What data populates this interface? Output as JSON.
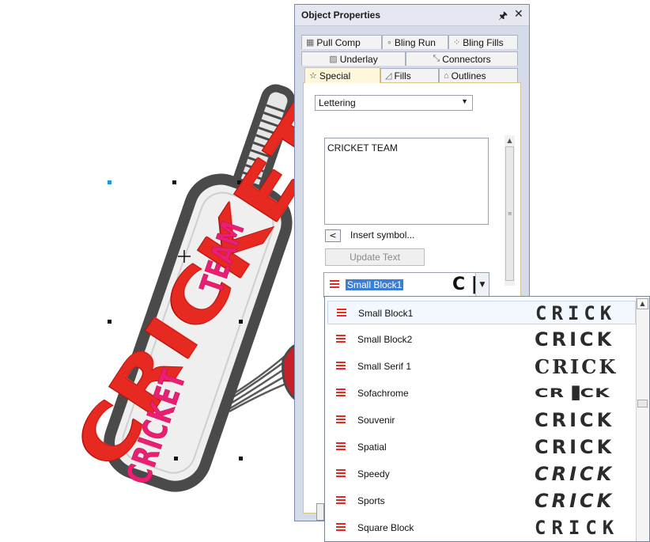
{
  "canvas": {
    "big_text": "CRICKET",
    "bat_text_left": "CRICKET",
    "bat_text_right": "TEAM"
  },
  "panel": {
    "title": "Object Properties",
    "pin_icon": "pin-icon",
    "close_icon": "close-icon",
    "tabs_row1": [
      {
        "label": "Pull Comp",
        "icon": "pull-comp-icon"
      },
      {
        "label": "Bling Run",
        "icon": "bling-run-icon"
      },
      {
        "label": "Bling Fills",
        "icon": "bling-fills-icon"
      }
    ],
    "tabs_row2": [
      {
        "label": "Underlay",
        "icon": "underlay-icon"
      },
      {
        "label": "Connectors",
        "icon": "connectors-icon"
      }
    ],
    "tabs_row3": [
      {
        "label": "Special",
        "icon": "star-icon",
        "active": true
      },
      {
        "label": "Fills",
        "icon": "fills-icon"
      },
      {
        "label": "Outlines",
        "icon": "outlines-icon"
      }
    ],
    "object_type": "Lettering",
    "text_value": "CRICKET TEAM",
    "insert_button": "<",
    "insert_label": "Insert symbol...",
    "update_button": "Update Text",
    "font_selected": "Small Block1",
    "font_preview": "C |"
  },
  "dropdown": {
    "items": [
      {
        "name": "Small Block1",
        "preview": "CRICK",
        "selected": true
      },
      {
        "name": "Small Block2",
        "preview": "CRICK"
      },
      {
        "name": "Small Serif 1",
        "preview": "CRICK"
      },
      {
        "name": "Sofachrome",
        "preview": "CR▐CK"
      },
      {
        "name": "Souvenir",
        "preview": "CRICK"
      },
      {
        "name": "Spatial",
        "preview": "CRICK"
      },
      {
        "name": "Speedy",
        "preview": "CRICK"
      },
      {
        "name": "Sports",
        "preview": "CRICK"
      },
      {
        "name": "Square Block",
        "preview": "CRICK"
      }
    ]
  },
  "colors": {
    "embroidery_red": "#e62a22",
    "embroidery_pink": "#ea1f73",
    "bat_outline": "#4a4a4a",
    "selection_blue": "#3b7ed6"
  }
}
